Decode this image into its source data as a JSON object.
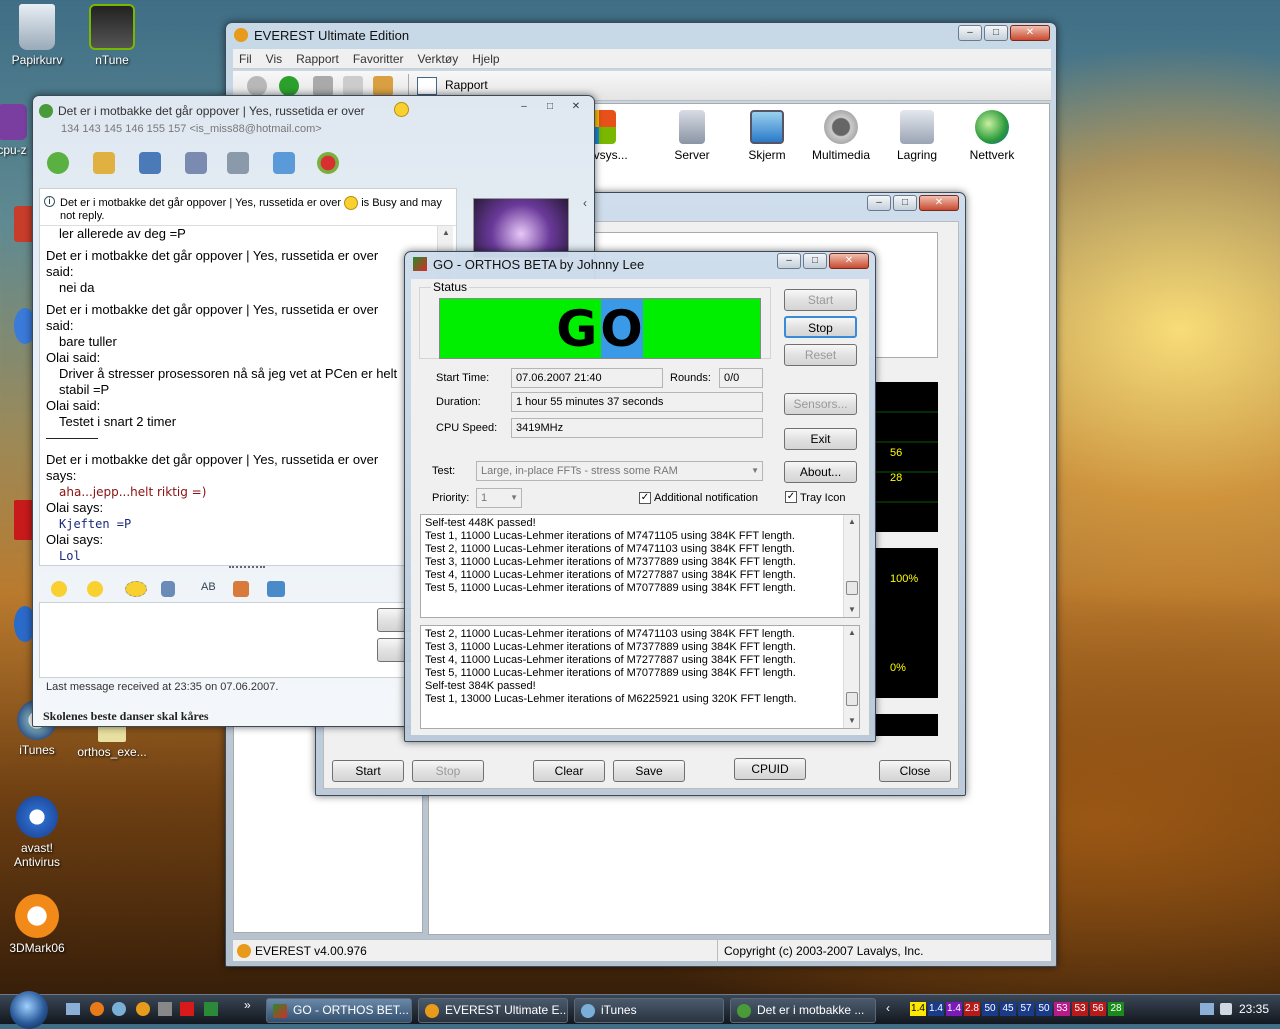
{
  "desktop": {
    "icons": [
      {
        "id": "papirkurv",
        "label": "Papirkurv",
        "icon": "recycle-bin-icon"
      },
      {
        "id": "ntune",
        "label": "nTune",
        "icon": "nvidia-icon"
      },
      {
        "id": "cpu",
        "label": "cpu-z",
        "icon": "cpu-z-icon"
      },
      {
        "id": "itunes",
        "label": "iTunes",
        "icon": "itunes-icon"
      },
      {
        "id": "orthos",
        "label": "orthos_exe...",
        "icon": "orthos-icon"
      },
      {
        "id": "avast",
        "label": "avast! Antivirus",
        "icon": "avast-icon"
      },
      {
        "id": "3dmark",
        "label": "3DMark06",
        "icon": "3dmark-icon"
      }
    ]
  },
  "everest": {
    "title": "EVEREST Ultimate Edition",
    "menu": [
      "Fil",
      "Vis",
      "Rapport",
      "Favoritter",
      "Verktøy",
      "Hjelp"
    ],
    "toolbar_report": "Rapport",
    "items": [
      "erativsys...",
      "Server",
      "Skjerm",
      "Multimedia",
      "Lagring",
      "Nettverk"
    ],
    "status_left": "EVEREST v4.00.976",
    "status_right": "Copyright (c) 2003-2007 Lavalys, Inc."
  },
  "stability": {
    "buttons": {
      "start": "Start",
      "stop": "Stop",
      "clear": "Clear",
      "save": "Save",
      "cpuid": "CPUID",
      "close": "Close"
    },
    "graph_labels": [
      "56",
      "28",
      "100%",
      "0%"
    ]
  },
  "chat": {
    "title": "Det er i motbakke det går oppover | Yes, russetida er over",
    "subtitle": "134 143 145 146 155 157 <is_miss88@hotmail.com>",
    "info": "Det er i motbakke det går oppover | Yes, russetida er over",
    "info_suffix": "is Busy and may not reply.",
    "messages": [
      {
        "t": "ler allerede av deg =P",
        "s": "ind"
      },
      {
        "t": "Det er i motbakke det går oppover | Yes, russetida er over",
        "s": "name"
      },
      {
        "t": "said:",
        "s": "plain"
      },
      {
        "t": "nei da",
        "s": "ind"
      },
      {
        "t": "Det er i motbakke det går oppover | Yes, russetida er over",
        "s": "name"
      },
      {
        "t": "said:",
        "s": "plain"
      },
      {
        "t": "bare tuller",
        "s": "ind"
      },
      {
        "t": "Olai said:",
        "s": "plain"
      },
      {
        "t": "Driver å stresser prosessoren nå så jeg vet at PCen er helt",
        "s": "ind"
      },
      {
        "t": "stabil =P",
        "s": "ind"
      },
      {
        "t": "Olai said:",
        "s": "plain"
      },
      {
        "t": "Testet i snart 2 timer",
        "s": "ind"
      },
      {
        "t": "————",
        "s": "plain"
      },
      {
        "t": "Det er i motbakke det går oppover | Yes, russetida er over",
        "s": "name"
      },
      {
        "t": "says:",
        "s": "plain"
      },
      {
        "t": "aha...jepp...helt riktig =)",
        "s": "red"
      },
      {
        "t": "Olai says:",
        "s": "plain"
      },
      {
        "t": "Kjeften =P",
        "s": "mono"
      },
      {
        "t": "Olai says:",
        "s": "plain"
      },
      {
        "t": "Lol",
        "s": "mono"
      }
    ],
    "status_line": "Last message received at 23:35 on 07.06.2007.",
    "bottom": "Skolenes beste danser skal kåres"
  },
  "orthos": {
    "title": "GO - ORTHOS BETA by Johnny Lee",
    "status_label": "Status",
    "go_text": "GO",
    "start_time_label": "Start Time:",
    "start_time": "07.06.2007 21:40",
    "rounds_label": "Rounds:",
    "rounds": "0/0",
    "duration_label": "Duration:",
    "duration": "1 hour 55 minutes 37 seconds",
    "cpu_label": "CPU Speed:",
    "cpu": "3419MHz",
    "test_label": "Test:",
    "test": "Large, in-place FFTs - stress some RAM",
    "priority_label": "Priority:",
    "priority": "1",
    "addnotif": "Additional notification",
    "tray": "Tray Icon",
    "buttons": {
      "start": "Start",
      "stop": "Stop",
      "reset": "Reset",
      "sensors": "Sensors...",
      "exit": "Exit",
      "about": "About..."
    },
    "log1": [
      "Self-test 448K passed!",
      "Test 1, 11000 Lucas-Lehmer iterations of M7471105 using 384K FFT length.",
      "Test 2, 11000 Lucas-Lehmer iterations of M7471103 using 384K FFT length.",
      "Test 3, 11000 Lucas-Lehmer iterations of M7377889 using 384K FFT length.",
      "Test 4, 11000 Lucas-Lehmer iterations of M7277887 using 384K FFT length.",
      "Test 5, 11000 Lucas-Lehmer iterations of M7077889 using 384K FFT length."
    ],
    "log2": [
      "Test 2, 11000 Lucas-Lehmer iterations of M7471103 using 384K FFT length.",
      "Test 3, 11000 Lucas-Lehmer iterations of M7377889 using 384K FFT length.",
      "Test 4, 11000 Lucas-Lehmer iterations of M7277887 using 384K FFT length.",
      "Test 5, 11000 Lucas-Lehmer iterations of M7077889 using 384K FFT length.",
      "Self-test 384K passed!",
      "Test 1, 13000 Lucas-Lehmer iterations of M6225921 using 320K FFT length."
    ]
  },
  "taskbar": {
    "tasks": [
      "GO - ORTHOS BET...",
      "EVEREST Ultimate E...",
      "iTunes",
      "Det er i motbakke ..."
    ],
    "tray_nums": [
      "1.4",
      "1.4",
      "1.4",
      "2.8",
      "50",
      "45",
      "57",
      "50",
      "53",
      "53",
      "56",
      "28"
    ],
    "clock": "23:35"
  }
}
